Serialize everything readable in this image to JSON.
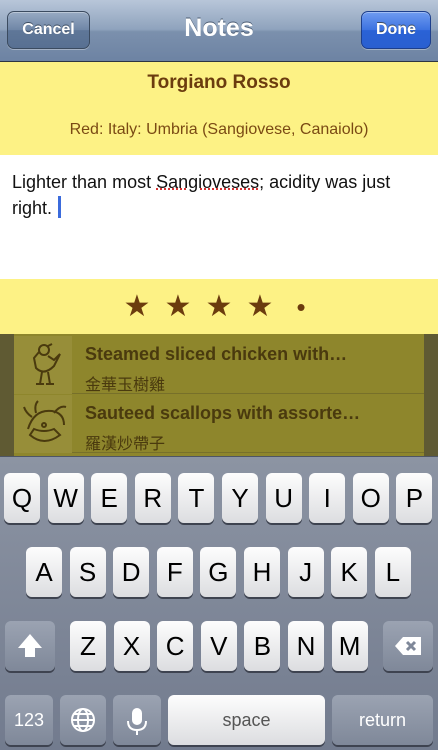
{
  "navbar": {
    "title": "Notes",
    "cancel_label": "Cancel",
    "done_label": "Done"
  },
  "wine": {
    "name": "Torgiano Rosso",
    "details": "Red: Italy: Umbria (Sangiovese, Canaiolo)"
  },
  "notes": {
    "text_before": "Lighter than most ",
    "misspelled_word": "Sangioveses",
    "text_after": "; acidity was just right."
  },
  "rating": {
    "stars": 4,
    "max": 5,
    "star_glyph": "★",
    "empty_glyph": "•"
  },
  "dishes": [
    {
      "title": "Steamed sliced chicken with…",
      "subtitle": "金華玉樹雞",
      "icon": "chicken-icon"
    },
    {
      "title": "Sauteed scallops with assorte…",
      "subtitle": "羅漢炒帶子",
      "icon": "scallop-icon"
    }
  ],
  "keyboard": {
    "row1": [
      "Q",
      "W",
      "E",
      "R",
      "T",
      "Y",
      "U",
      "I",
      "O",
      "P"
    ],
    "row2": [
      "A",
      "S",
      "D",
      "F",
      "G",
      "H",
      "J",
      "K",
      "L"
    ],
    "row3": [
      "Z",
      "X",
      "C",
      "V",
      "B",
      "N",
      "M"
    ],
    "numbers_label": "123",
    "space_label": "space",
    "return_label": "return"
  },
  "colors": {
    "note_yellow": "#fdf285",
    "accent_brown": "#6b3c0e",
    "done_blue": "#2a62d6"
  }
}
